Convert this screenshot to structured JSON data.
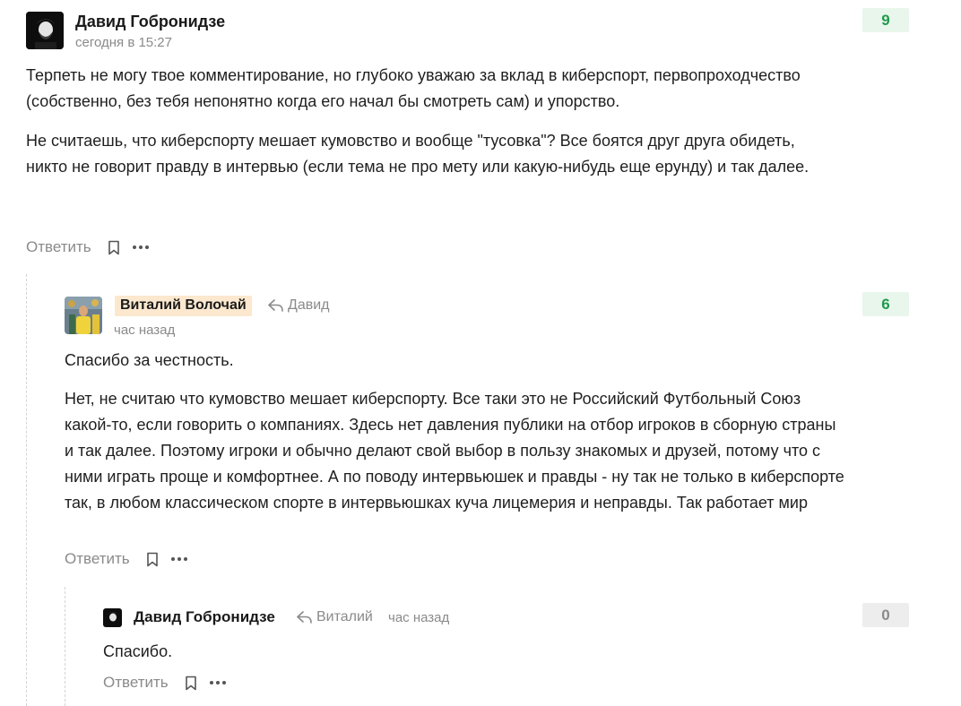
{
  "comments": [
    {
      "author": "Давид Гобронидзе",
      "time": "сегодня в 15:27",
      "score": "9",
      "paragraphs": [
        "Терпеть не могу твое комментирование, но глубоко уважаю за вклад в киберспорт, первопроходчество (собственно, без тебя непонятно когда его начал бы смотреть сам) и упорство.",
        "Не считаешь, что киберспорту мешает кумовство и вообще \"тусовка\"? Все боятся друг друга обидеть, никто не говорит правду в интервью (если тема не про мету или какую-нибудь еще ерунду) и так далее."
      ],
      "reply_label": "Ответить"
    },
    {
      "author": "Виталий Волочай",
      "reply_to": "Давид",
      "time": "час назад",
      "score": "6",
      "paragraphs": [
        "Спасибо за честность.",
        "Нет, не считаю что кумовство мешает киберспорту. Все таки это не Российский Футбольный Союз какой-то, если говорить о компаниях. Здесь нет давления публики на отбор игроков в сборную страны и так далее. Поэтому игроки и обычно делают свой выбор в пользу знакомых и друзей, потому что с ними играть проще и комфортнее. А по поводу интервьюшек и правды - ну так не только в киберспорте так, в любом классическом спорте в интервьюшках куча лицемерия и неправды. Так работает мир"
      ],
      "reply_label": "Ответить"
    },
    {
      "author": "Давид Гобронидзе",
      "reply_to": "Виталий",
      "time": "час назад",
      "score": "0",
      "paragraphs": [
        "Спасибо."
      ],
      "reply_label": "Ответить"
    }
  ],
  "icons": {
    "bookmark": "bookmark-icon",
    "more": "more-dots-icon",
    "reply_arrow": "reply-arrow-icon"
  },
  "colors": {
    "score_positive_bg": "#e8f6ec",
    "score_positive_text": "#1f9a4b",
    "score_zero_bg": "#ededed",
    "author_highlight": "#fbe8cf"
  }
}
